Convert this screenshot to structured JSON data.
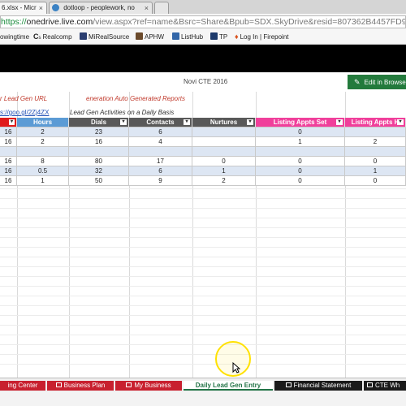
{
  "browser": {
    "tabs": [
      {
        "label": "6.xlsx - Micr",
        "active": true
      },
      {
        "label": "dotloop - peoplework, no",
        "active": false
      }
    ],
    "url": {
      "secure": "https://",
      "host": "onedrive.live.com",
      "path": "/view.aspx?ref=name&Bsrc=Share&Bpub=SDX.SkyDrive&resid=807362B4457FD9E"
    },
    "bookmarks": [
      {
        "label": "owingtime",
        "icon": "bookmark-icon",
        "color": "#777777"
      },
      {
        "label": "Realcomp",
        "icon": "realcomp-icon",
        "color": "#3a3a3a"
      },
      {
        "label": "MiRealSource",
        "icon": "mirealsource-icon",
        "color": "#2b3e70"
      },
      {
        "label": "APHW",
        "icon": "aphw-icon",
        "color": "#6b4a2b"
      },
      {
        "label": "ListHub",
        "icon": "listhub-icon",
        "color": "#3266a8"
      },
      {
        "label": "TP",
        "icon": "tp-icon",
        "color": "#1d3a6b"
      },
      {
        "label": "Log In | Firepoint",
        "icon": "firepoint-icon",
        "color": "#d9531e"
      }
    ]
  },
  "office": {
    "doc_title": "Novi CTE 2016",
    "edit_button": "Edit in Browser",
    "accent": "#237a3c"
  },
  "sheet": {
    "note1": "r Lead Gen URL",
    "note2": "eneration Auto Generated Reports",
    "link": "s://goo.gl/2Zj4ZX",
    "note3": "Lead Gen Activities on a Daily Basis",
    "headers": [
      {
        "label": "",
        "color": "#e01b1b"
      },
      {
        "label": "Hours",
        "color": "#5b9bd5"
      },
      {
        "label": "Dials",
        "color": "#595959"
      },
      {
        "label": "Contacts",
        "color": "#595959"
      },
      {
        "label": "Nurtures",
        "color": "#595959"
      },
      {
        "label": "Listing Appts Set",
        "color": "#f03f9b"
      },
      {
        "label": "Listing Appts H",
        "color": "#f03f9b"
      }
    ],
    "rows": [
      [
        "16",
        "2",
        "23",
        "6",
        "",
        "0",
        ""
      ],
      [
        "16",
        "2",
        "16",
        "4",
        "",
        "1",
        "2"
      ],
      [
        "",
        "",
        "",
        "",
        "",
        "",
        ""
      ],
      [
        "16",
        "8",
        "80",
        "17",
        "0",
        "0",
        "0"
      ],
      [
        "16",
        "0.5",
        "32",
        "6",
        "1",
        "0",
        "1"
      ],
      [
        "16",
        "1",
        "50",
        "9",
        "2",
        "0",
        "0"
      ]
    ]
  },
  "sheet_tabs": [
    {
      "label": "ing Center",
      "color": "#c8202f",
      "locked": false,
      "active": false
    },
    {
      "label": "Business Plan",
      "color": "#c8202f",
      "locked": true,
      "active": false
    },
    {
      "label": "My Business",
      "color": "#c8202f",
      "locked": true,
      "active": false
    },
    {
      "label": "Daily Lead Gen Entry",
      "color": "#217346",
      "locked": false,
      "active": true
    },
    {
      "label": "Financial Statement",
      "color": "#1a1a1a",
      "locked": true,
      "active": false
    },
    {
      "label": "CTE Wh",
      "color": "#1a1a1a",
      "locked": true,
      "active": false
    }
  ]
}
